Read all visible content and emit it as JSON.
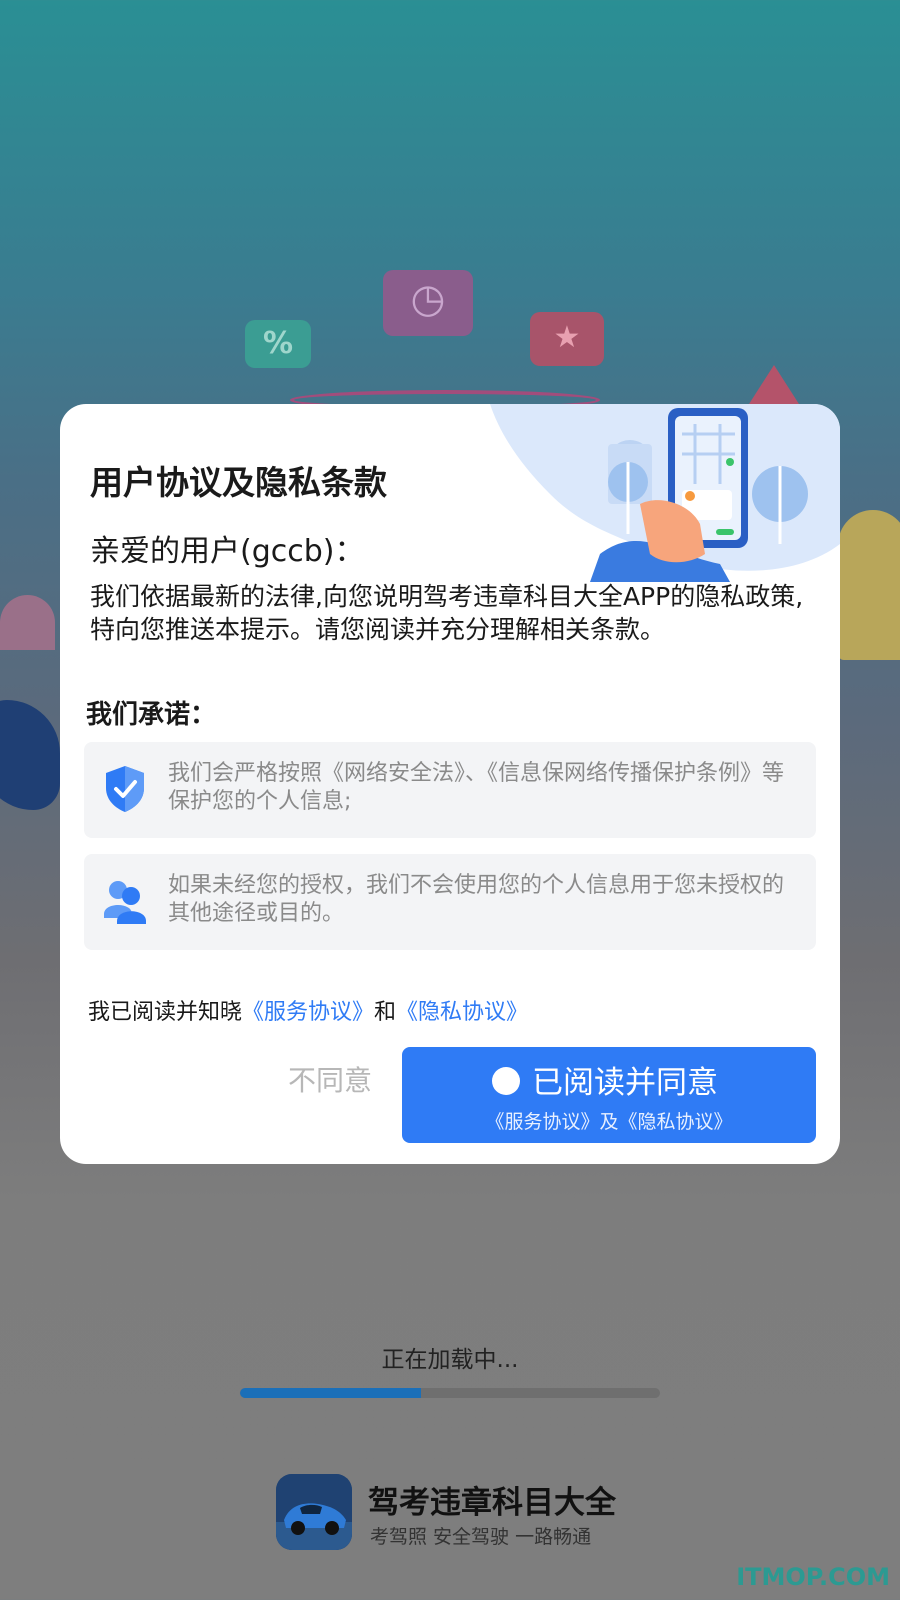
{
  "dialog": {
    "title": "用户协议及隐私条款",
    "greeting": "亲爱的用户(gccb)：",
    "body": "我们依据最新的法律,向您说明驾考违章科目大全APP的隐私政策,特向您推送本提示。请您阅读并充分理解相关条款。",
    "promise_title": "我们承诺：",
    "promises": [
      {
        "icon": "shield-check-icon",
        "text": "我们会严格按照《网络安全法》、《信息保网络传播保护条例》等保护您的个人信息;"
      },
      {
        "icon": "users-icon",
        "text": "如果未经您的授权，我们不会使用您的个人信息用于您未授权的其他途径或目的。"
      }
    ],
    "agree_line": {
      "prefix": "我已阅读并知晓",
      "service_link": "《服务协议》",
      "and": "和",
      "privacy_link": "《隐私协议》"
    },
    "disagree_label": "不同意",
    "agree_label": "已阅读并同意",
    "agree_sub": "《服务协议》及《隐私协议》"
  },
  "loading": {
    "text": "正在加载中...",
    "progress": 0.43
  },
  "app": {
    "name": "驾考违章科目大全",
    "slogan": "考驾照 安全驾驶 一路畅通"
  },
  "watermark": "ITMOP.COM",
  "colors": {
    "accent": "#2f7bf5",
    "progress_fill": "#1b6fb8"
  }
}
